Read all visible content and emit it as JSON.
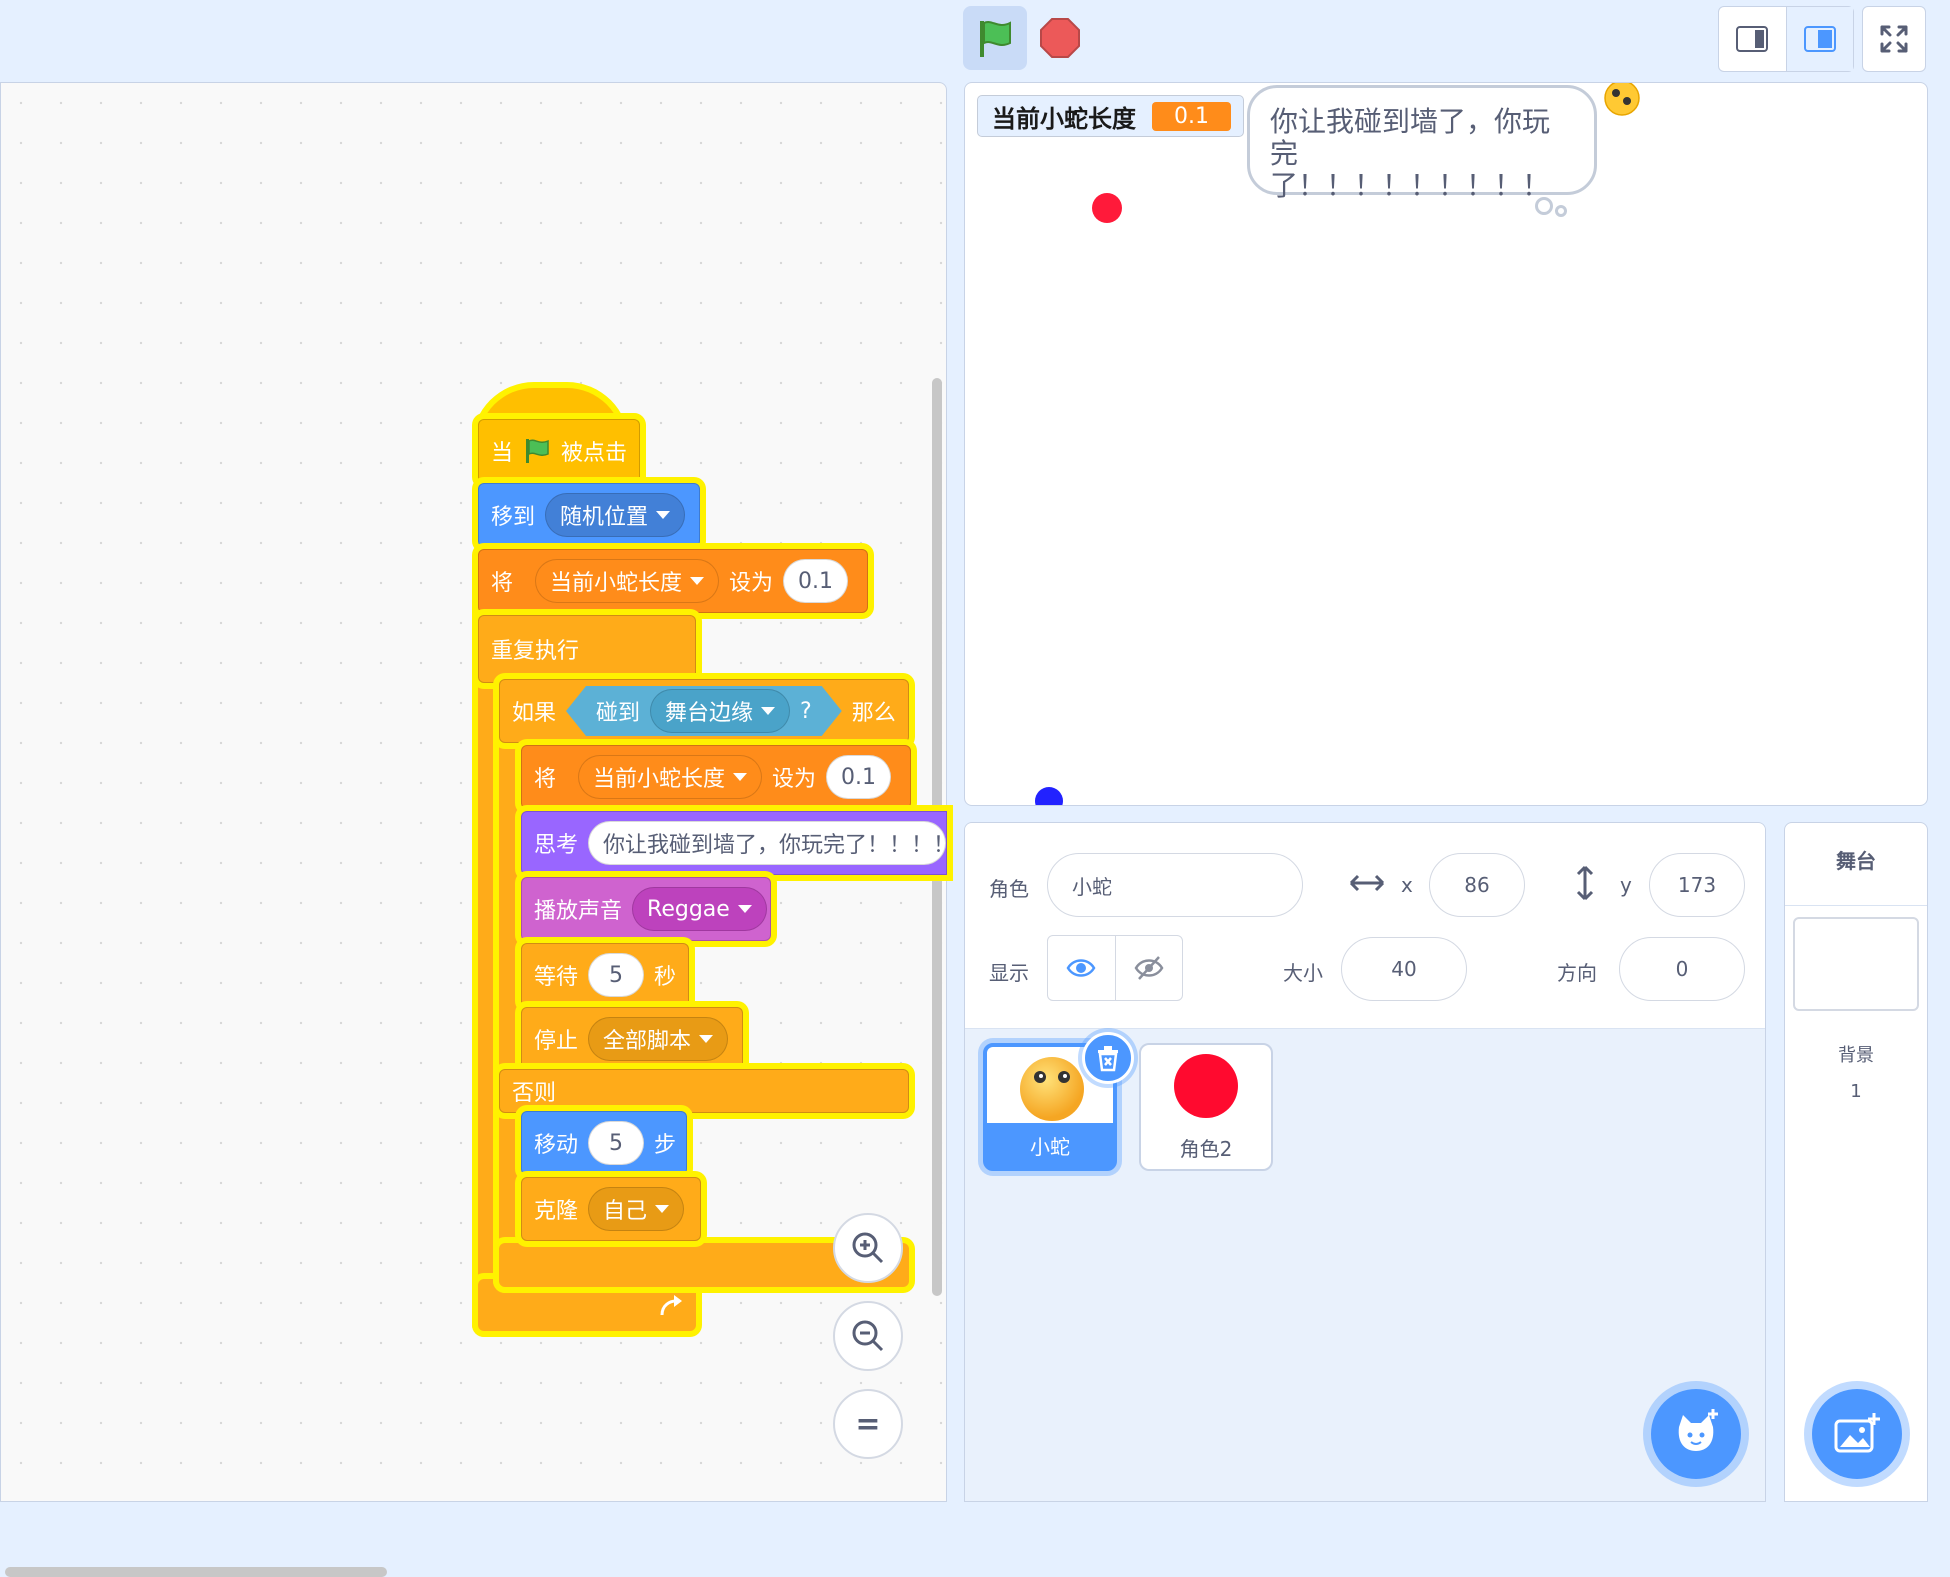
{
  "toolbar": {
    "green_flag_icon": "green-flag-icon",
    "stop_icon": "stop-icon",
    "layout_modes": [
      "small-stage-icon",
      "large-stage-icon"
    ],
    "fullscreen_icon": "fullscreen-icon"
  },
  "colors": {
    "accent": "#4c97ff",
    "events": "#ffbf00",
    "motion": "#4c97ff",
    "variables": "#ff8c1a",
    "control": "#ffab19",
    "looks": "#9966ff",
    "sound": "#cf63cf",
    "sensing": "#5cb1d6",
    "glow": "#fff200"
  },
  "script": {
    "hat": {
      "when": "当",
      "clicked": "被点击"
    },
    "goto": {
      "label": "移到",
      "target": "随机位置"
    },
    "set_var_1": {
      "label": "将",
      "variable": "当前小蛇长度",
      "to": "设为",
      "value": "0.1"
    },
    "forever": {
      "label": "重复执行"
    },
    "if": {
      "label": "如果",
      "then": "那么"
    },
    "touching": {
      "label": "碰到",
      "target": "舞台边缘",
      "q": "?"
    },
    "set_var_2": {
      "label": "将",
      "variable": "当前小蛇长度",
      "to": "设为",
      "value": "0.1"
    },
    "think": {
      "label": "思考",
      "text": "你让我碰到墙了，你玩完了！！！！"
    },
    "play_sound": {
      "label": "播放声音",
      "sound": "Reggae"
    },
    "wait": {
      "label": "等待",
      "value": "5",
      "unit": "秒"
    },
    "stop": {
      "label": "停止",
      "option": "全部脚本"
    },
    "else": {
      "label": "否则"
    },
    "move": {
      "label": "移动",
      "value": "5",
      "unit": "步"
    },
    "clone": {
      "label": "克隆",
      "target": "自己"
    }
  },
  "zoom": {
    "zoom_in_icon": "zoom-in-icon",
    "zoom_out_icon": "zoom-out-icon",
    "reset_label": "="
  },
  "stage": {
    "monitor_label": "当前小蛇长度",
    "monitor_value": "0.1",
    "bubble_line1": "你让我碰到墙了，你玩完",
    "bubble_line2": "了！！！！！！！！！"
  },
  "sprite_info": {
    "sprite_label": "角色",
    "sprite_name": "小蛇",
    "x_label": "x",
    "x_value": "86",
    "y_label": "y",
    "y_value": "173",
    "show_label": "显示",
    "size_label": "大小",
    "size_value": "40",
    "direction_label": "方向",
    "direction_value": "0"
  },
  "sprites": [
    {
      "name": "小蛇",
      "selected": true
    },
    {
      "name": "角色2",
      "selected": false
    }
  ],
  "stage_pane": {
    "title": "舞台",
    "backdrop_label": "背景",
    "backdrop_count": "1"
  }
}
